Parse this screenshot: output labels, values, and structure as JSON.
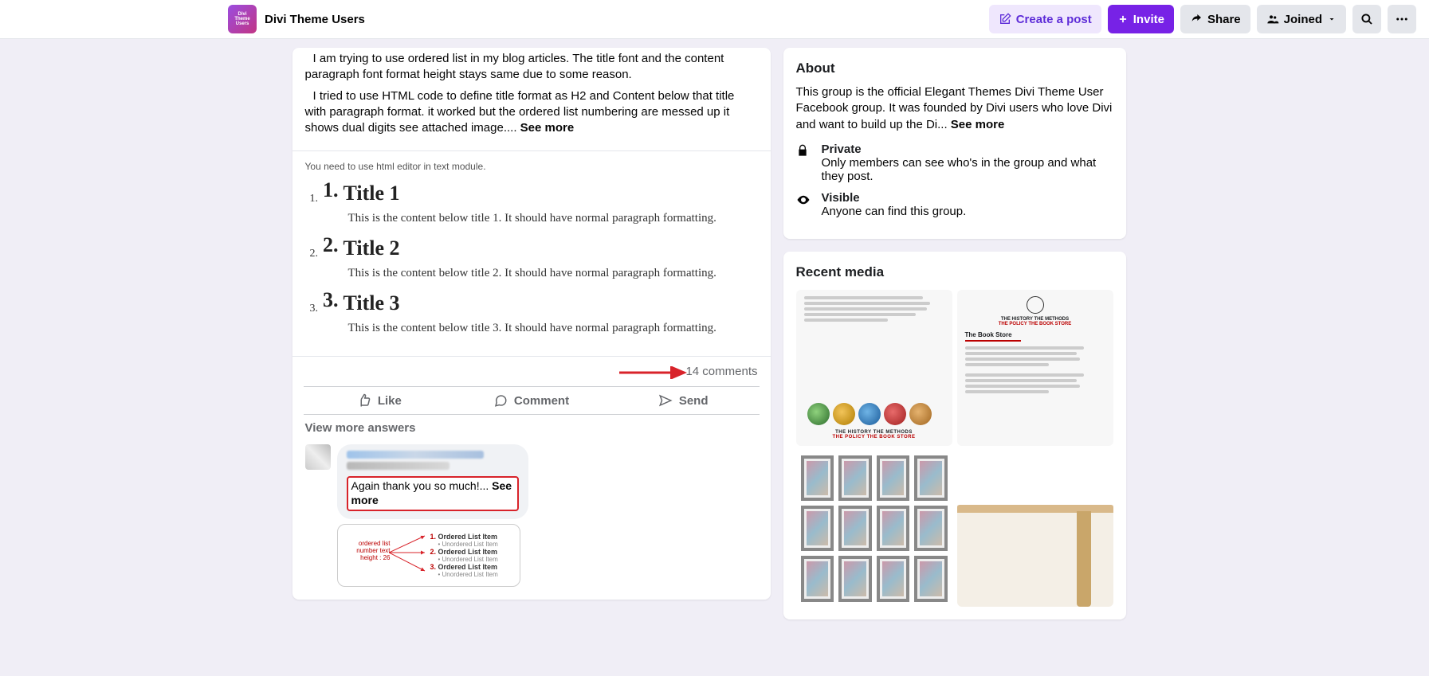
{
  "header": {
    "group_name": "Divi Theme Users",
    "create_post": "Create a post",
    "invite": "Invite",
    "share": "Share",
    "joined": "Joined"
  },
  "post": {
    "p1": "I am trying to use ordered list in my blog articles. The title font and the content paragraph font format height stays same due to some reason.",
    "p2_a": "I tried to use HTML code to define title format as H2 and Content below that title with paragraph format. it worked but the ordered list numbering are messed up it shows dual digits see attached image.... ",
    "see_more": "See more",
    "code_note": "You need to use html editor in text module.",
    "items": [
      {
        "outer": "1.",
        "big": "1.",
        "title": "Title 1",
        "body": "This is the content below title 1. It should have normal paragraph formatting."
      },
      {
        "outer": "2.",
        "big": "2.",
        "title": "Title 2",
        "body": "This is the content below title 2. It should have normal paragraph formatting."
      },
      {
        "outer": "3.",
        "big": "3.",
        "title": "Title 3",
        "body": "This is the content below title 3. It should have normal paragraph formatting."
      }
    ],
    "comments_count": "14 comments",
    "like": "Like",
    "comment": "Comment",
    "send": "Send",
    "view_more": "View more answers",
    "reply_text": "Again thank you so much!... ",
    "reply_see_more": "See more",
    "diagram": {
      "label": "ordered list number text height : 26",
      "rows": [
        {
          "num": "1.",
          "t": "Ordered List Item"
        },
        {
          "bullet": true,
          "t": "Unordered List Item"
        },
        {
          "num": "2.",
          "t": "Ordered List Item"
        },
        {
          "bullet": true,
          "t": "Unordered List Item"
        },
        {
          "num": "3.",
          "t": "Ordered List Item"
        },
        {
          "bullet": true,
          "t": "Unordered List Item"
        }
      ]
    }
  },
  "about": {
    "heading": "About",
    "text_a": "This group is the official Elegant Themes Divi Theme User Facebook group. It was founded by Divi users who love Divi and want to build up the Di... ",
    "see_more": "See more",
    "private_title": "Private",
    "private_sub": "Only members can see who's in the group and what they post.",
    "visible_title": "Visible",
    "visible_sub": "Anyone can find this group."
  },
  "media": {
    "heading": "Recent media",
    "tile1": {
      "top": "THE HISTORY   THE METHODS",
      "bottom": "THE POLICY   THE BOOK STORE"
    },
    "tile2": {
      "toprow": "THE HISTORY   THE METHODS",
      "toprow2": "THE POLICY   THE BOOK STORE",
      "brand": "The Book Store"
    }
  }
}
